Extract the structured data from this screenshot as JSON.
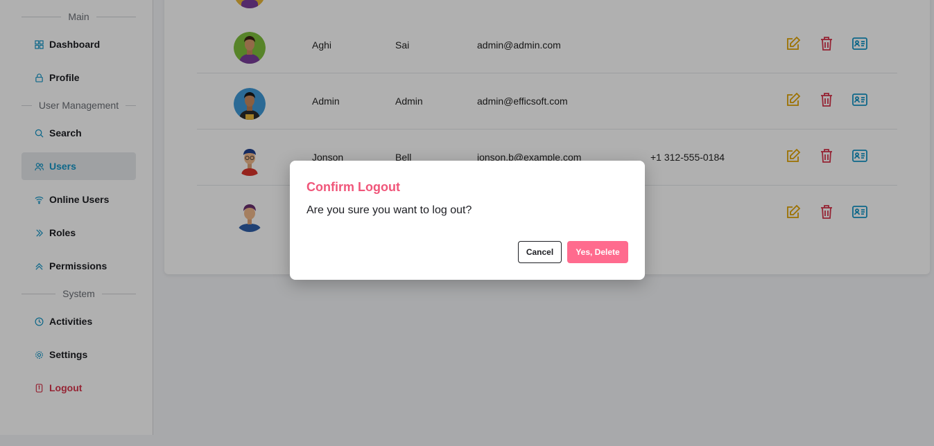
{
  "sidebar": {
    "sections": {
      "main": "Main",
      "user_management": "User Management",
      "system": "System"
    },
    "items": {
      "dashboard": "Dashboard",
      "profile": "Profile",
      "search": "Search",
      "users": "Users",
      "online_users": "Online Users",
      "roles": "Roles",
      "permissions": "Permissions",
      "activities": "Activities",
      "settings": "Settings",
      "logout": "Logout"
    },
    "active_item": "Users"
  },
  "users_table": {
    "rows": [
      {
        "first_name": "Aghi",
        "last_name": "Sai",
        "email": "admin@admin.com",
        "phone": ""
      },
      {
        "first_name": "Admin",
        "last_name": "Admin",
        "email": "admin@efficsoft.com",
        "phone": ""
      },
      {
        "first_name": "Jonson",
        "last_name": "Bell",
        "email": "jonson.b@example.com",
        "phone": "+1 312-555-0184"
      },
      {
        "first_name": "",
        "last_name": "",
        "email": "",
        "phone": ""
      }
    ],
    "action_icons": [
      "edit-icon",
      "trash-icon",
      "id-card-icon"
    ]
  },
  "modal": {
    "title": "Confirm Logout",
    "message": "Are you sure you want to log out?",
    "cancel_label": "Cancel",
    "confirm_label": "Yes, Delete"
  },
  "colors": {
    "accent": "#1396c7",
    "danger": "#d8344b",
    "edit": "#e2a400",
    "modal_title": "#f0567a",
    "confirm_button": "#ff6b8e"
  }
}
